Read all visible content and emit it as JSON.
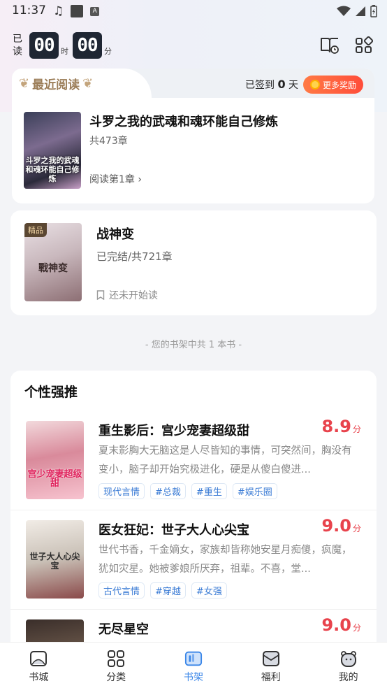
{
  "status_bar": {
    "time": "11:37"
  },
  "timer": {
    "label": "已读",
    "hours": "00",
    "hours_unit": "时",
    "minutes": "00",
    "minutes_unit": "分"
  },
  "recent": {
    "title": "最近阅读",
    "signin_prefix": "已签到",
    "signin_days": "0",
    "signin_suffix": "天",
    "reward_label": "更多奖励",
    "book": {
      "title": "斗罗之我的武魂和魂环能自己修炼",
      "chapters": "共473章",
      "progress": "阅读第1章",
      "cover_text": "斗罗之我的武魂和魂环能自己修炼"
    }
  },
  "shelf": {
    "book": {
      "badge": "精品",
      "title": "战神变",
      "meta": "已完结/共721章",
      "status": "还未开始读",
      "cover_text": "戰神变"
    },
    "count_text": "- 您的书架中共 1 本书 -"
  },
  "recommend": {
    "title": "个性强推",
    "score_unit": "分",
    "items": [
      {
        "name": "重生影后：宫少宠妻超级甜",
        "score": "8.9",
        "desc": "夏末影胸大无脑这是人尽皆知的事情，可突然间，胸没有变小，脑子却开始究极进化，硬是从傻白傻进...",
        "tags": [
          "现代言情",
          "#总裁",
          "#重生",
          "#娱乐圈"
        ],
        "cover_text": "宫少宠妻超级甜"
      },
      {
        "name": "医女狂妃：世子大人心尖宝",
        "score": "9.0",
        "desc": "世代书香，千金嫡女，家族却皆称她安星月痴傻，疯魔，犹如灾星。她被爹娘所厌弃，祖辈。不喜，堂...",
        "tags": [
          "古代言情",
          "#穿越",
          "#女强"
        ],
        "cover_text": "世子大人心尖宝"
      },
      {
        "name": "无尽星空",
        "score": "9.0",
        "desc": "",
        "tags": [],
        "cover_text": ""
      }
    ]
  },
  "nav": {
    "items": [
      {
        "label": "书城",
        "icon": "bookstore-icon"
      },
      {
        "label": "分类",
        "icon": "category-icon"
      },
      {
        "label": "书架",
        "icon": "bookshelf-icon"
      },
      {
        "label": "福利",
        "icon": "welfare-icon"
      },
      {
        "label": "我的",
        "icon": "profile-icon"
      }
    ],
    "active": "书架"
  },
  "colors": {
    "accent": "#3a86e8",
    "score": "#e8434c",
    "reward": "#ff5a3c",
    "timer_box": "#1f2633"
  }
}
